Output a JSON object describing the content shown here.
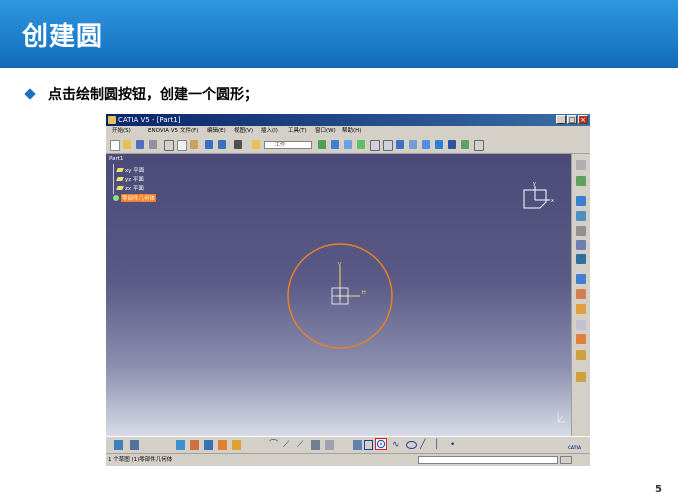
{
  "slide": {
    "title": "创建圆",
    "bullet": "点击绘制圆按钮，创建一个圆形；",
    "page_number": "5"
  },
  "window": {
    "title": "CATIA V5 - [Part1]",
    "controls": {
      "minimize": "_",
      "restore": "□",
      "close": "×"
    }
  },
  "menu": [
    "开始(S)",
    "ENOVIA V5",
    "文件(F)",
    "编辑(E)",
    "视图(V)",
    "插入(I)",
    "工具(T)",
    "窗口(W)",
    "帮助(H)"
  ],
  "toolbar": {
    "field_value": "工作"
  },
  "tree": {
    "root": "Part1",
    "items": [
      {
        "label": "xy 平面",
        "kind": "plane"
      },
      {
        "label": "yz 平面",
        "kind": "plane"
      },
      {
        "label": "zx 平面",
        "kind": "plane"
      },
      {
        "label": "零部件几何体",
        "kind": "body",
        "selected": true
      }
    ]
  },
  "compass": {
    "y_label": "y",
    "x_label": "x"
  },
  "sketch": {
    "h_label": "H",
    "v_label": "V"
  },
  "brand": "CATIA",
  "status": {
    "text": "1 个草图 (1)零部件几何体"
  },
  "colors": {
    "header": "#1a79c8",
    "circle": "#e8802a",
    "selection": "#f08020",
    "highlight_border": "#e02020"
  }
}
